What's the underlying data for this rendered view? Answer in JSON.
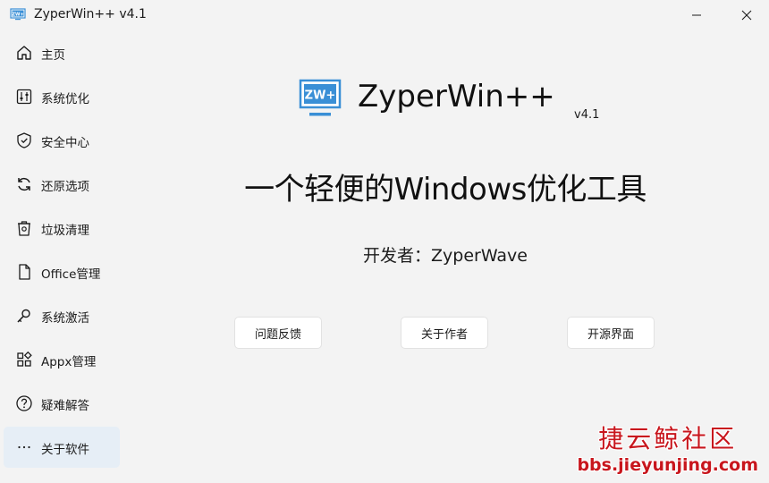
{
  "window": {
    "title": "ZyperWin++ v4.1",
    "icon": "zw-monitor-icon",
    "controls": [
      "minimize-icon",
      "close-icon"
    ]
  },
  "sidebar": {
    "items": [
      {
        "label": "主页",
        "icon": "home-icon"
      },
      {
        "label": "系统优化",
        "icon": "sliders-icon"
      },
      {
        "label": "安全中心",
        "icon": "shield-check-icon"
      },
      {
        "label": "还原选项",
        "icon": "refresh-icon"
      },
      {
        "label": "垃圾清理",
        "icon": "trash-icon"
      },
      {
        "label": "Office管理",
        "icon": "document-icon"
      },
      {
        "label": "系统激活",
        "icon": "key-icon"
      },
      {
        "label": "Appx管理",
        "icon": "apps-icon"
      },
      {
        "label": "疑难解答",
        "icon": "question-icon"
      },
      {
        "label": "关于软件",
        "icon": "more-icon",
        "active": true
      }
    ]
  },
  "about": {
    "logo_text": "ZW+",
    "app_name": "ZyperWin++",
    "version": "v4.1",
    "tagline": "一个轻便的Windows优化工具",
    "developer": "开发者：ZyperWave",
    "buttons": {
      "feedback": "问题反馈",
      "about_author": "关于作者",
      "open_source": "开源界面"
    }
  },
  "watermark": {
    "title": "捷云鲸社区",
    "url": "bbs.jieyunjing.com"
  },
  "colors": {
    "background": "#f3f3f3",
    "sidebar_active": "#e6eef6",
    "logo_blue": "#3a8fd6",
    "watermark_red": "#c8161d"
  }
}
